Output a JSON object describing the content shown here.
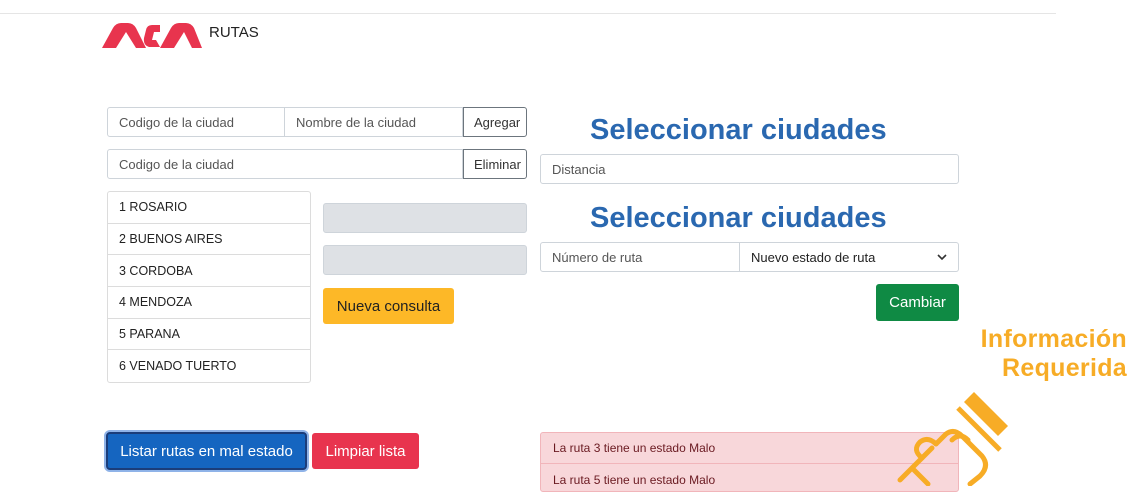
{
  "brand": {
    "name": "RUTAS",
    "logo_icon": "aca-logo-icon",
    "color": "#e8344e"
  },
  "add_form": {
    "code_placeholder": "Codigo de la ciudad",
    "name_placeholder": "Nombre de la ciudad",
    "add_label": "Agregar"
  },
  "delete_form": {
    "code_placeholder": "Codigo de la ciudad",
    "delete_label": "Eliminar"
  },
  "cities": [
    "1 ROSARIO",
    "2 BUENOS AIRES",
    "3 CORDOBA",
    "4 MENDOZA",
    "5 PARANA",
    "6 VENADO TUERTO"
  ],
  "query": {
    "new_query_label": "Nueva consulta",
    "accent": "#fdb827"
  },
  "distance_section": {
    "heading": "Seleccionar ciudades",
    "distance_placeholder": "Distancia"
  },
  "route_section": {
    "heading": "Seleccionar ciudades",
    "route_number_placeholder": "Número de ruta",
    "state_select_value": "Nuevo estado de ruta",
    "change_label": "Cambiar"
  },
  "actions": {
    "list_bad_routes": "Listar rutas en mal estado",
    "clear_list": "Limpiar lista"
  },
  "results": [
    "La ruta 3 tiene un estado Malo",
    "La ruta 5 tiene un estado Malo"
  ],
  "promo": {
    "line1": "Información",
    "line2": "Requerida",
    "icon": "pointing-hand-icon",
    "color": "#f7ac26"
  }
}
